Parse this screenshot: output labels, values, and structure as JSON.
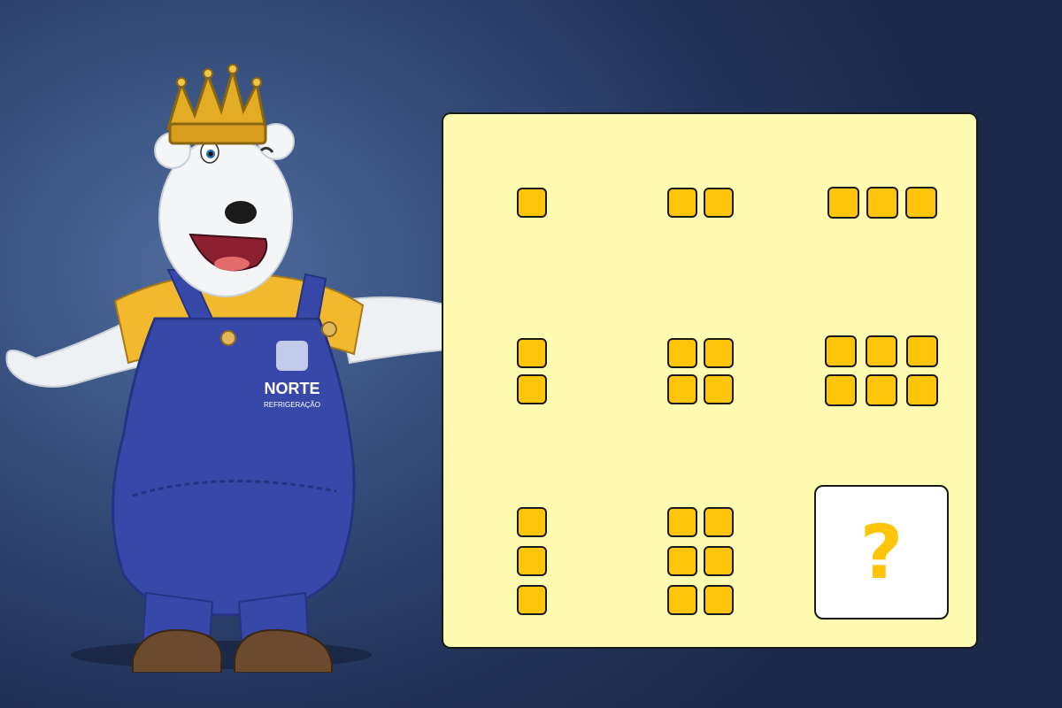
{
  "mascot": {
    "brand_name": "NORTE",
    "brand_sub": "REFRIGERAÇÃO"
  },
  "puzzle": {
    "tile_color": "#ffc50a",
    "board_color": "#fffbb0",
    "cells": [
      {
        "rows": 1,
        "cols": 1
      },
      {
        "rows": 1,
        "cols": 2
      },
      {
        "rows": 1,
        "cols": 3
      },
      {
        "rows": 2,
        "cols": 1
      },
      {
        "rows": 2,
        "cols": 2
      },
      {
        "rows": 2,
        "cols": 3
      },
      {
        "rows": 3,
        "cols": 1
      },
      {
        "rows": 3,
        "cols": 2
      },
      {
        "missing": true
      }
    ],
    "missing_symbol": "?"
  }
}
